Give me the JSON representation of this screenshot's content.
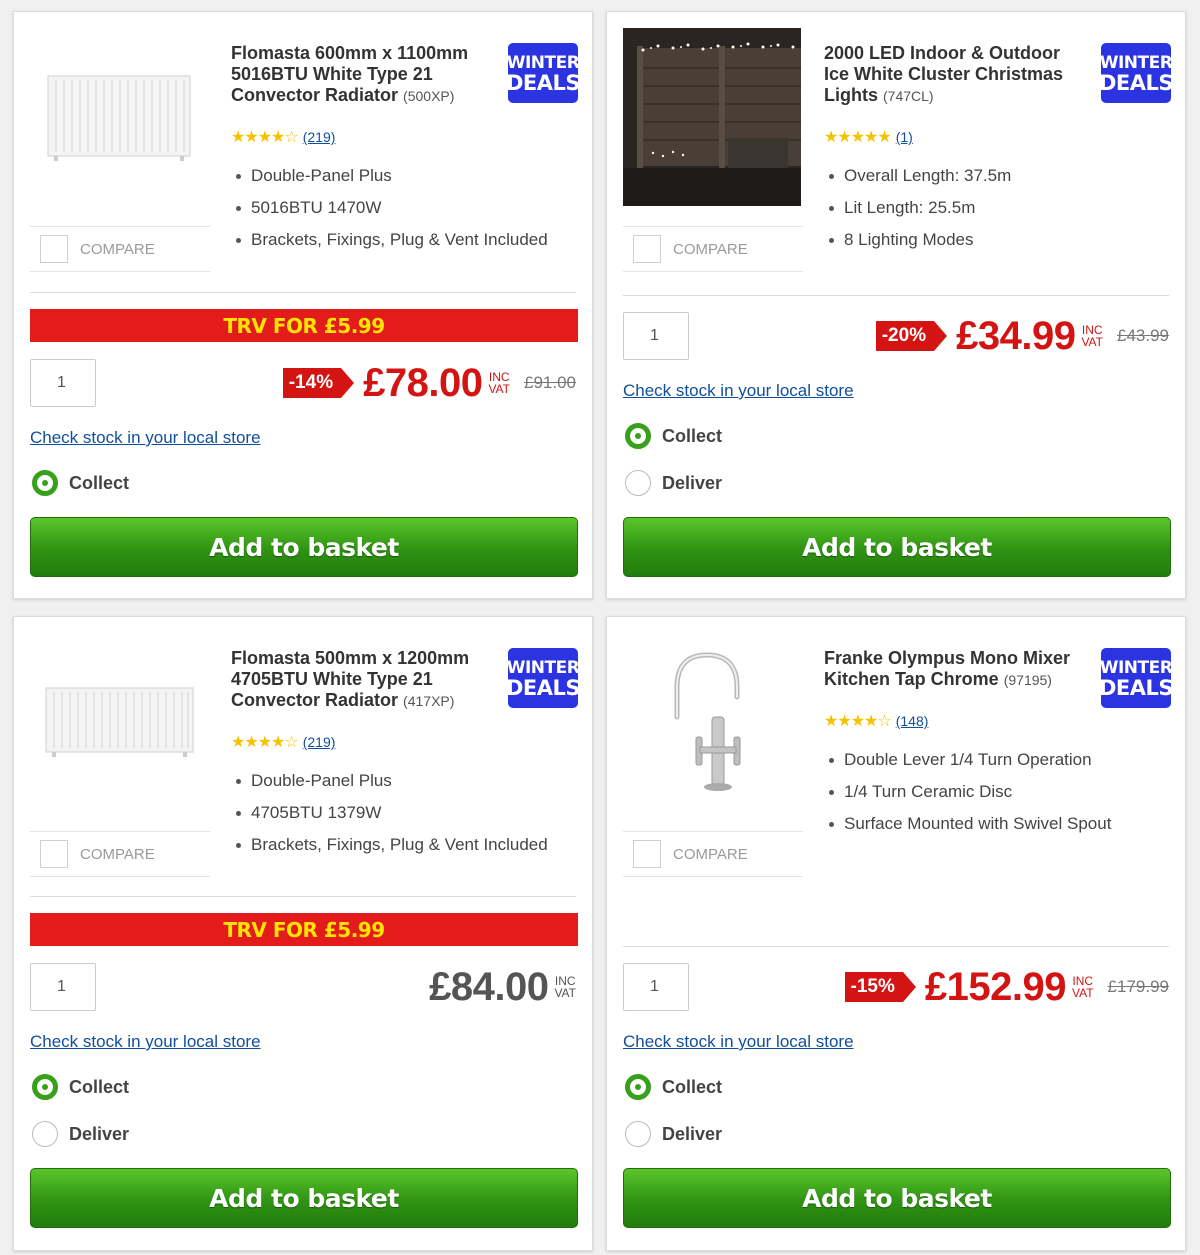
{
  "badge": {
    "line1": "WINTER",
    "line2": "DEALS"
  },
  "compare_label": "COMPARE",
  "stock_link": "Check stock in your local store",
  "collect_label": "Collect",
  "deliver_label": "Deliver",
  "add_to_basket": "Add to basket",
  "inc": "INC",
  "vat": "VAT",
  "stars_full": "★★★★★",
  "stars_half": "★★★★☆",
  "products": [
    {
      "title": "Flomasta 600mm x 1100mm 5016BTU White Type 21 Convector Radiator",
      "code": "(500XP)",
      "reviews": "(219)",
      "features": [
        "Double-Panel Plus",
        "5016BTU 1470W",
        "Brackets, Fixings, Plug & Vent Included"
      ],
      "promo": "TRV FOR £5.99",
      "qty": "1",
      "discount": "-14%",
      "price": "£78.00",
      "was": "£91.00"
    },
    {
      "title": "2000 LED Indoor & Outdoor Ice White Cluster Christmas Lights",
      "code": "(747CL)",
      "reviews": "(1)",
      "features": [
        "Overall Length: 37.5m",
        "Lit Length: 25.5m",
        "8 Lighting Modes"
      ],
      "qty": "1",
      "discount": "-20%",
      "price": "£34.99",
      "was": "£43.99"
    },
    {
      "title": "Flomasta 500mm x 1200mm 4705BTU White Type 21 Convector Radiator",
      "code": "(417XP)",
      "reviews": "(219)",
      "features": [
        "Double-Panel Plus",
        "4705BTU 1379W",
        "Brackets, Fixings, Plug & Vent Included"
      ],
      "promo": "TRV FOR £5.99",
      "qty": "1",
      "price": "£84.00"
    },
    {
      "title": "Franke Olympus Mono Mixer Kitchen Tap Chrome",
      "code": "(97195)",
      "reviews": "(148)",
      "features": [
        "Double Lever 1/4 Turn Operation",
        "1/4 Turn Ceramic Disc",
        "Surface Mounted with Swivel Spout"
      ],
      "qty": "1",
      "discount": "-15%",
      "price": "£152.99",
      "was": "£179.99"
    }
  ]
}
